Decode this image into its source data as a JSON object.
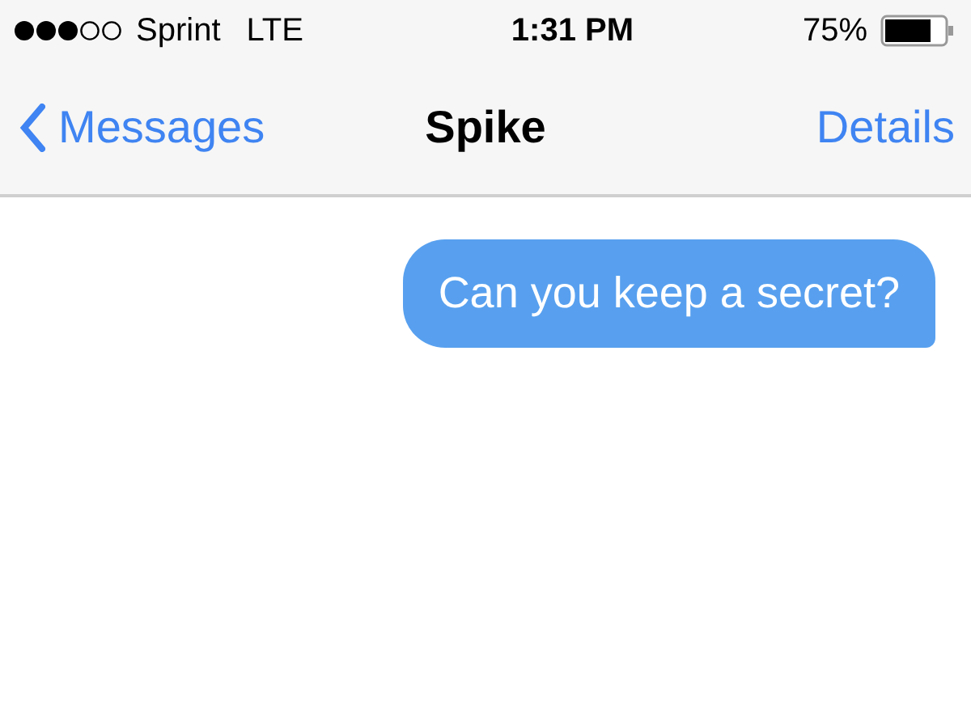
{
  "status_bar": {
    "carrier": "Sprint",
    "network": "LTE",
    "time": "1:31 PM",
    "battery": "75%"
  },
  "nav_bar": {
    "back": "Messages",
    "title": "Spike",
    "action": "Details"
  },
  "messages": [
    {
      "kind": "sent",
      "text": "Can you keep a secret?"
    }
  ]
}
